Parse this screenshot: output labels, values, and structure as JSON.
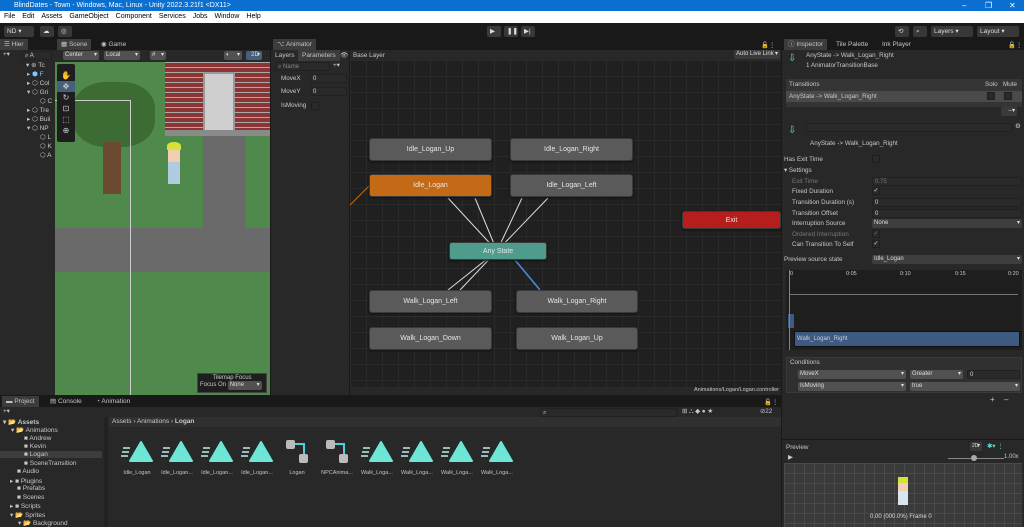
{
  "window": {
    "title": "BlindDates - Town - Windows, Mac, Linux - Unity 2022.3.21f1 <DX11>",
    "minimize": "–",
    "maximize": "❐",
    "close": "✕"
  },
  "menu": [
    "File",
    "Edit",
    "Assets",
    "GameObject",
    "Component",
    "Services",
    "Jobs",
    "Window",
    "Help"
  ],
  "toolbar": {
    "account": "ND ▾",
    "layers": "Layers",
    "layout": "Layout"
  },
  "hierarchy": {
    "tab": "Hier",
    "search": "A",
    "items": [
      "Tc",
      "F",
      "Col",
      "Gri",
      "C",
      "Tre",
      "Buil",
      "NP",
      "L",
      "K",
      "A"
    ]
  },
  "scene": {
    "tabs": [
      "Scene",
      "Game"
    ],
    "pivot": "Center",
    "space": "Local",
    "mode2d": "2D",
    "tilemap_focus": "Tilemap Focus",
    "focus_on": "Focus On",
    "focus_value": "None"
  },
  "animator": {
    "tab": "Animator",
    "subtabs": [
      "Layers",
      "Parameters"
    ],
    "layer": "Base Layer",
    "auto_live_link": "Auto Live Link",
    "search_placeholder": "Name",
    "parameters": [
      {
        "name": "MoveX",
        "value": "0"
      },
      {
        "name": "MoveY",
        "value": "0"
      },
      {
        "name": "IsMoving",
        "value": ""
      }
    ],
    "states": {
      "idle_up": "Idle_Logan_Up",
      "idle_right": "Idle_Logan_Right",
      "idle": "Idle_Logan",
      "idle_left": "Idle_Logan_Left",
      "exit": "Exit",
      "any": "Any State",
      "walk_left": "Walk_Logan_Left",
      "walk_right": "Walk_Logan_Right",
      "walk_down": "Walk_Logan_Down",
      "walk_up": "Walk_Logan_Up"
    },
    "path": "Animations/Logan/Logan.controller",
    "colors": {
      "default": "#5a5a5a",
      "entry": "#c46a16",
      "any": "#4f9b8c",
      "exit": "#b81d1d"
    }
  },
  "inspector": {
    "tabs": [
      "Inspector",
      "Tile Palette",
      "Ink Player"
    ],
    "header_title": "AnyState -> Walk_Logan_Right",
    "header_sub": "1 AnimatorTransitionBase",
    "transitions_label": "Transitions",
    "solo": "Solo",
    "mute": "Mute",
    "transition_row": "AnyState -> Walk_Logan_Right",
    "minus": "–",
    "name_label": "AnyState -> Walk_Logan_Right",
    "has_exit_time": "Has Exit Time",
    "settings": "Settings",
    "exit_time_label": "Exit Time",
    "exit_time": "0.75",
    "fixed_duration": "Fixed Duration",
    "transition_duration_label": "Transition Duration (s)",
    "transition_duration": "0",
    "transition_offset_label": "Transition Offset",
    "transition_offset": "0",
    "interruption_source_label": "Interruption Source",
    "interruption_source": "None",
    "ordered_interruption": "Ordered Interruption",
    "can_transition_to_self": "Can Transition To Self",
    "preview_source_label": "Preview source state",
    "preview_source": "Idle_Logan",
    "timeline_ticks": [
      "0",
      "0:05",
      "0:10",
      "0:15",
      "0:20"
    ],
    "timeline_clip": "Walk_Logan_Right",
    "conditions_label": "Conditions",
    "conditions": [
      {
        "param": "MoveX",
        "mode": "Greater",
        "value": "0"
      },
      {
        "param": "IsMoving",
        "mode": "true"
      }
    ],
    "plus": "+",
    "minus2": "–"
  },
  "preview": {
    "title": "Preview",
    "mode2d": "2D",
    "speed": "1.00x",
    "status": "0.00 (000.0%) Frame 0"
  },
  "project": {
    "tabs": [
      "Project",
      "Console",
      "Animation"
    ],
    "breadcrumb": [
      "Assets",
      "Animations",
      "Logan"
    ],
    "hidden_count": "22",
    "tree": [
      "Assets",
      "Animations",
      "Andrew",
      "Kevin",
      "Logan",
      "SceneTransition",
      "Audio",
      "Plugins",
      "Prefabs",
      "Scenes",
      "Scripts",
      "Sprites",
      "Background"
    ],
    "assets": [
      {
        "name": "Idle_Logan",
        "type": "clip"
      },
      {
        "name": "Idle_Logan...",
        "type": "clip"
      },
      {
        "name": "Idle_Logan...",
        "type": "clip"
      },
      {
        "name": "Idle_Logan...",
        "type": "clip"
      },
      {
        "name": "Logan",
        "type": "controller"
      },
      {
        "name": "NPCAnima...",
        "type": "controller"
      },
      {
        "name": "Walk_Loga...",
        "type": "clip"
      },
      {
        "name": "Walk_Loga...",
        "type": "clip"
      },
      {
        "name": "Walk_Loga...",
        "type": "clip"
      },
      {
        "name": "Walk_Loga...",
        "type": "clip"
      }
    ]
  }
}
